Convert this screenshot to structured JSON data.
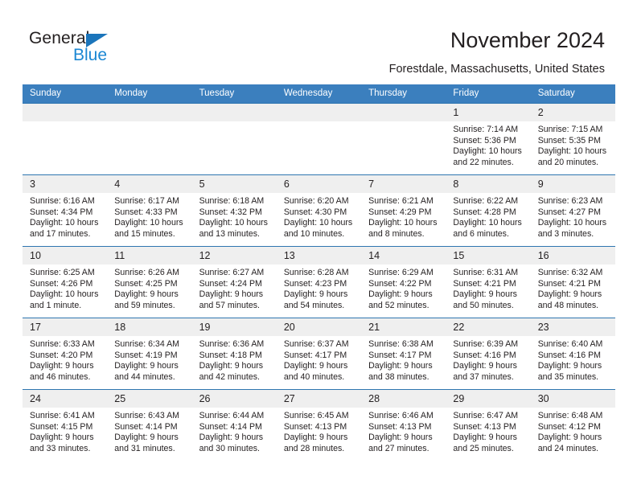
{
  "brand": {
    "name_part1": "General",
    "name_part2": "Blue",
    "triangle_color": "#1b75bb",
    "blue_color": "#1b87d3"
  },
  "header": {
    "title": "November 2024",
    "location": "Forestdale, Massachusetts, United States"
  },
  "theme": {
    "header_bg": "#3b7fbe",
    "row_divider": "#2e75b0",
    "daynum_bg": "#efefef",
    "text": "#231f20"
  },
  "calendar": {
    "weekday_headers": [
      "Sunday",
      "Monday",
      "Tuesday",
      "Wednesday",
      "Thursday",
      "Friday",
      "Saturday"
    ],
    "weeks": [
      [
        {
          "day": "",
          "sunrise": "",
          "sunset": "",
          "daylight": ""
        },
        {
          "day": "",
          "sunrise": "",
          "sunset": "",
          "daylight": ""
        },
        {
          "day": "",
          "sunrise": "",
          "sunset": "",
          "daylight": ""
        },
        {
          "day": "",
          "sunrise": "",
          "sunset": "",
          "daylight": ""
        },
        {
          "day": "",
          "sunrise": "",
          "sunset": "",
          "daylight": ""
        },
        {
          "day": "1",
          "sunrise": "Sunrise: 7:14 AM",
          "sunset": "Sunset: 5:36 PM",
          "daylight": "Daylight: 10 hours and 22 minutes."
        },
        {
          "day": "2",
          "sunrise": "Sunrise: 7:15 AM",
          "sunset": "Sunset: 5:35 PM",
          "daylight": "Daylight: 10 hours and 20 minutes."
        }
      ],
      [
        {
          "day": "3",
          "sunrise": "Sunrise: 6:16 AM",
          "sunset": "Sunset: 4:34 PM",
          "daylight": "Daylight: 10 hours and 17 minutes."
        },
        {
          "day": "4",
          "sunrise": "Sunrise: 6:17 AM",
          "sunset": "Sunset: 4:33 PM",
          "daylight": "Daylight: 10 hours and 15 minutes."
        },
        {
          "day": "5",
          "sunrise": "Sunrise: 6:18 AM",
          "sunset": "Sunset: 4:32 PM",
          "daylight": "Daylight: 10 hours and 13 minutes."
        },
        {
          "day": "6",
          "sunrise": "Sunrise: 6:20 AM",
          "sunset": "Sunset: 4:30 PM",
          "daylight": "Daylight: 10 hours and 10 minutes."
        },
        {
          "day": "7",
          "sunrise": "Sunrise: 6:21 AM",
          "sunset": "Sunset: 4:29 PM",
          "daylight": "Daylight: 10 hours and 8 minutes."
        },
        {
          "day": "8",
          "sunrise": "Sunrise: 6:22 AM",
          "sunset": "Sunset: 4:28 PM",
          "daylight": "Daylight: 10 hours and 6 minutes."
        },
        {
          "day": "9",
          "sunrise": "Sunrise: 6:23 AM",
          "sunset": "Sunset: 4:27 PM",
          "daylight": "Daylight: 10 hours and 3 minutes."
        }
      ],
      [
        {
          "day": "10",
          "sunrise": "Sunrise: 6:25 AM",
          "sunset": "Sunset: 4:26 PM",
          "daylight": "Daylight: 10 hours and 1 minute."
        },
        {
          "day": "11",
          "sunrise": "Sunrise: 6:26 AM",
          "sunset": "Sunset: 4:25 PM",
          "daylight": "Daylight: 9 hours and 59 minutes."
        },
        {
          "day": "12",
          "sunrise": "Sunrise: 6:27 AM",
          "sunset": "Sunset: 4:24 PM",
          "daylight": "Daylight: 9 hours and 57 minutes."
        },
        {
          "day": "13",
          "sunrise": "Sunrise: 6:28 AM",
          "sunset": "Sunset: 4:23 PM",
          "daylight": "Daylight: 9 hours and 54 minutes."
        },
        {
          "day": "14",
          "sunrise": "Sunrise: 6:29 AM",
          "sunset": "Sunset: 4:22 PM",
          "daylight": "Daylight: 9 hours and 52 minutes."
        },
        {
          "day": "15",
          "sunrise": "Sunrise: 6:31 AM",
          "sunset": "Sunset: 4:21 PM",
          "daylight": "Daylight: 9 hours and 50 minutes."
        },
        {
          "day": "16",
          "sunrise": "Sunrise: 6:32 AM",
          "sunset": "Sunset: 4:21 PM",
          "daylight": "Daylight: 9 hours and 48 minutes."
        }
      ],
      [
        {
          "day": "17",
          "sunrise": "Sunrise: 6:33 AM",
          "sunset": "Sunset: 4:20 PM",
          "daylight": "Daylight: 9 hours and 46 minutes."
        },
        {
          "day": "18",
          "sunrise": "Sunrise: 6:34 AM",
          "sunset": "Sunset: 4:19 PM",
          "daylight": "Daylight: 9 hours and 44 minutes."
        },
        {
          "day": "19",
          "sunrise": "Sunrise: 6:36 AM",
          "sunset": "Sunset: 4:18 PM",
          "daylight": "Daylight: 9 hours and 42 minutes."
        },
        {
          "day": "20",
          "sunrise": "Sunrise: 6:37 AM",
          "sunset": "Sunset: 4:17 PM",
          "daylight": "Daylight: 9 hours and 40 minutes."
        },
        {
          "day": "21",
          "sunrise": "Sunrise: 6:38 AM",
          "sunset": "Sunset: 4:17 PM",
          "daylight": "Daylight: 9 hours and 38 minutes."
        },
        {
          "day": "22",
          "sunrise": "Sunrise: 6:39 AM",
          "sunset": "Sunset: 4:16 PM",
          "daylight": "Daylight: 9 hours and 37 minutes."
        },
        {
          "day": "23",
          "sunrise": "Sunrise: 6:40 AM",
          "sunset": "Sunset: 4:16 PM",
          "daylight": "Daylight: 9 hours and 35 minutes."
        }
      ],
      [
        {
          "day": "24",
          "sunrise": "Sunrise: 6:41 AM",
          "sunset": "Sunset: 4:15 PM",
          "daylight": "Daylight: 9 hours and 33 minutes."
        },
        {
          "day": "25",
          "sunrise": "Sunrise: 6:43 AM",
          "sunset": "Sunset: 4:14 PM",
          "daylight": "Daylight: 9 hours and 31 minutes."
        },
        {
          "day": "26",
          "sunrise": "Sunrise: 6:44 AM",
          "sunset": "Sunset: 4:14 PM",
          "daylight": "Daylight: 9 hours and 30 minutes."
        },
        {
          "day": "27",
          "sunrise": "Sunrise: 6:45 AM",
          "sunset": "Sunset: 4:13 PM",
          "daylight": "Daylight: 9 hours and 28 minutes."
        },
        {
          "day": "28",
          "sunrise": "Sunrise: 6:46 AM",
          "sunset": "Sunset: 4:13 PM",
          "daylight": "Daylight: 9 hours and 27 minutes."
        },
        {
          "day": "29",
          "sunrise": "Sunrise: 6:47 AM",
          "sunset": "Sunset: 4:13 PM",
          "daylight": "Daylight: 9 hours and 25 minutes."
        },
        {
          "day": "30",
          "sunrise": "Sunrise: 6:48 AM",
          "sunset": "Sunset: 4:12 PM",
          "daylight": "Daylight: 9 hours and 24 minutes."
        }
      ]
    ]
  }
}
